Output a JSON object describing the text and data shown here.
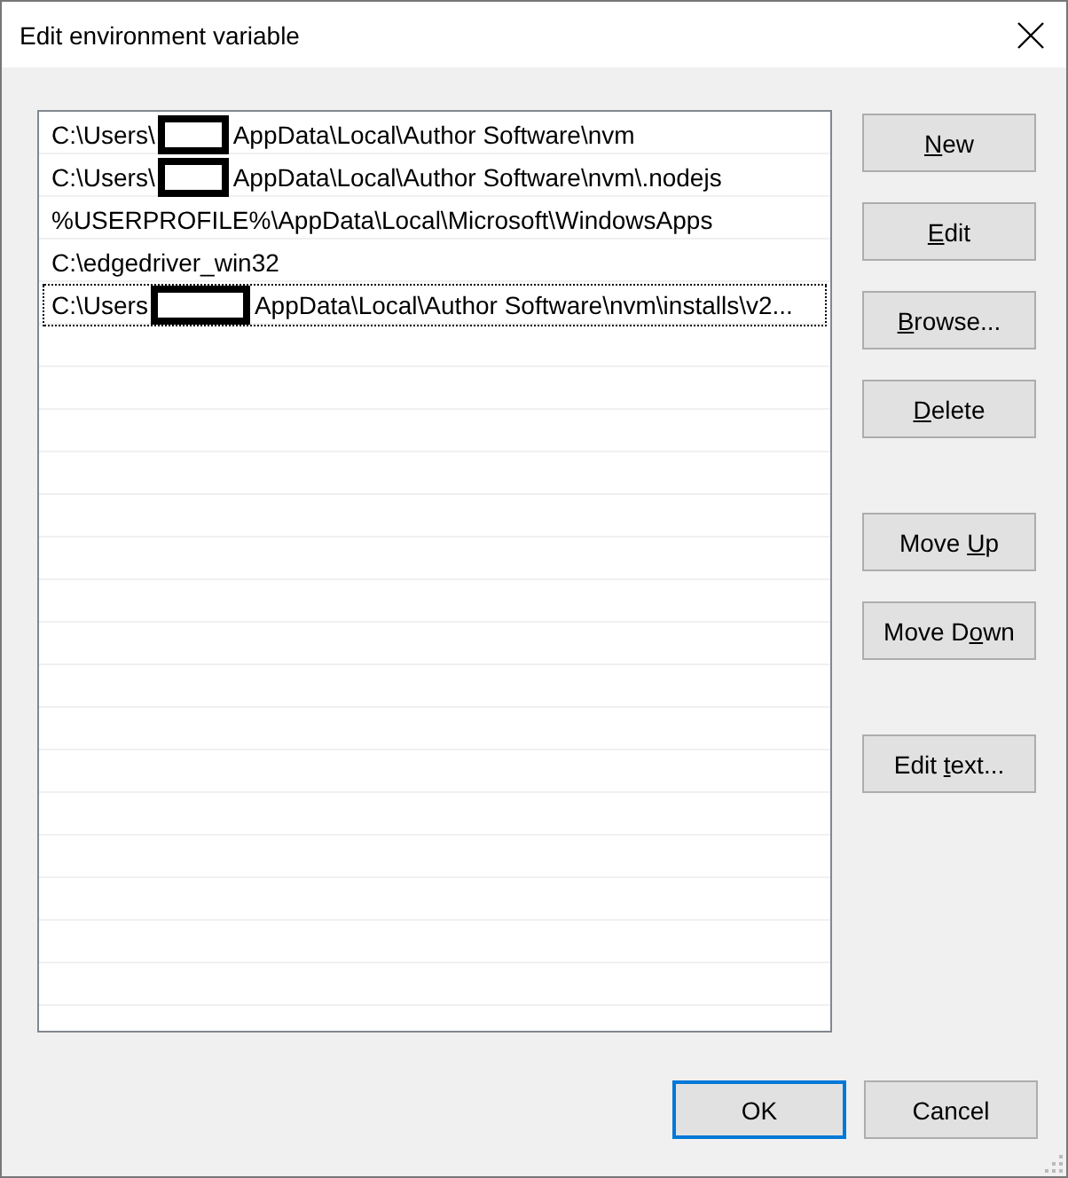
{
  "window": {
    "title": "Edit environment variable"
  },
  "list": {
    "rows": [
      {
        "prefix": "C:\\Users\\",
        "redacted": true,
        "suffix": "AppData\\Local\\Author Software\\nvm",
        "focused": false
      },
      {
        "prefix": "C:\\Users\\",
        "redacted": true,
        "suffix": "AppData\\Local\\Author Software\\nvm\\.nodejs",
        "focused": false
      },
      {
        "prefix": "%USERPROFILE%\\AppData\\Local\\Microsoft\\WindowsApps",
        "redacted": false,
        "focused": false
      },
      {
        "prefix": "C:\\edgedriver_win32",
        "redacted": false,
        "focused": false
      },
      {
        "prefix": "C:\\Users",
        "redacted": true,
        "suffix": "AppData\\Local\\Author Software\\nvm\\installs\\v2...",
        "focused": true
      }
    ]
  },
  "button_groups": [
    {
      "buttons": [
        {
          "key": "N",
          "after": "ew"
        },
        {
          "key": "E",
          "after": "dit"
        },
        {
          "key": "B",
          "after": "rowse..."
        },
        {
          "key": "D",
          "after": "elete"
        }
      ]
    },
    {
      "buttons": [
        {
          "before": "Move ",
          "key": "U",
          "after": "p"
        },
        {
          "before": "Move D",
          "key": "o",
          "after": "wn"
        }
      ]
    },
    {
      "buttons": [
        {
          "before": "Edit ",
          "key": "t",
          "after": "ext..."
        }
      ]
    }
  ],
  "footer_buttons": [
    {
      "label": "OK",
      "default": true
    },
    {
      "label": "Cancel",
      "default": false
    }
  ]
}
